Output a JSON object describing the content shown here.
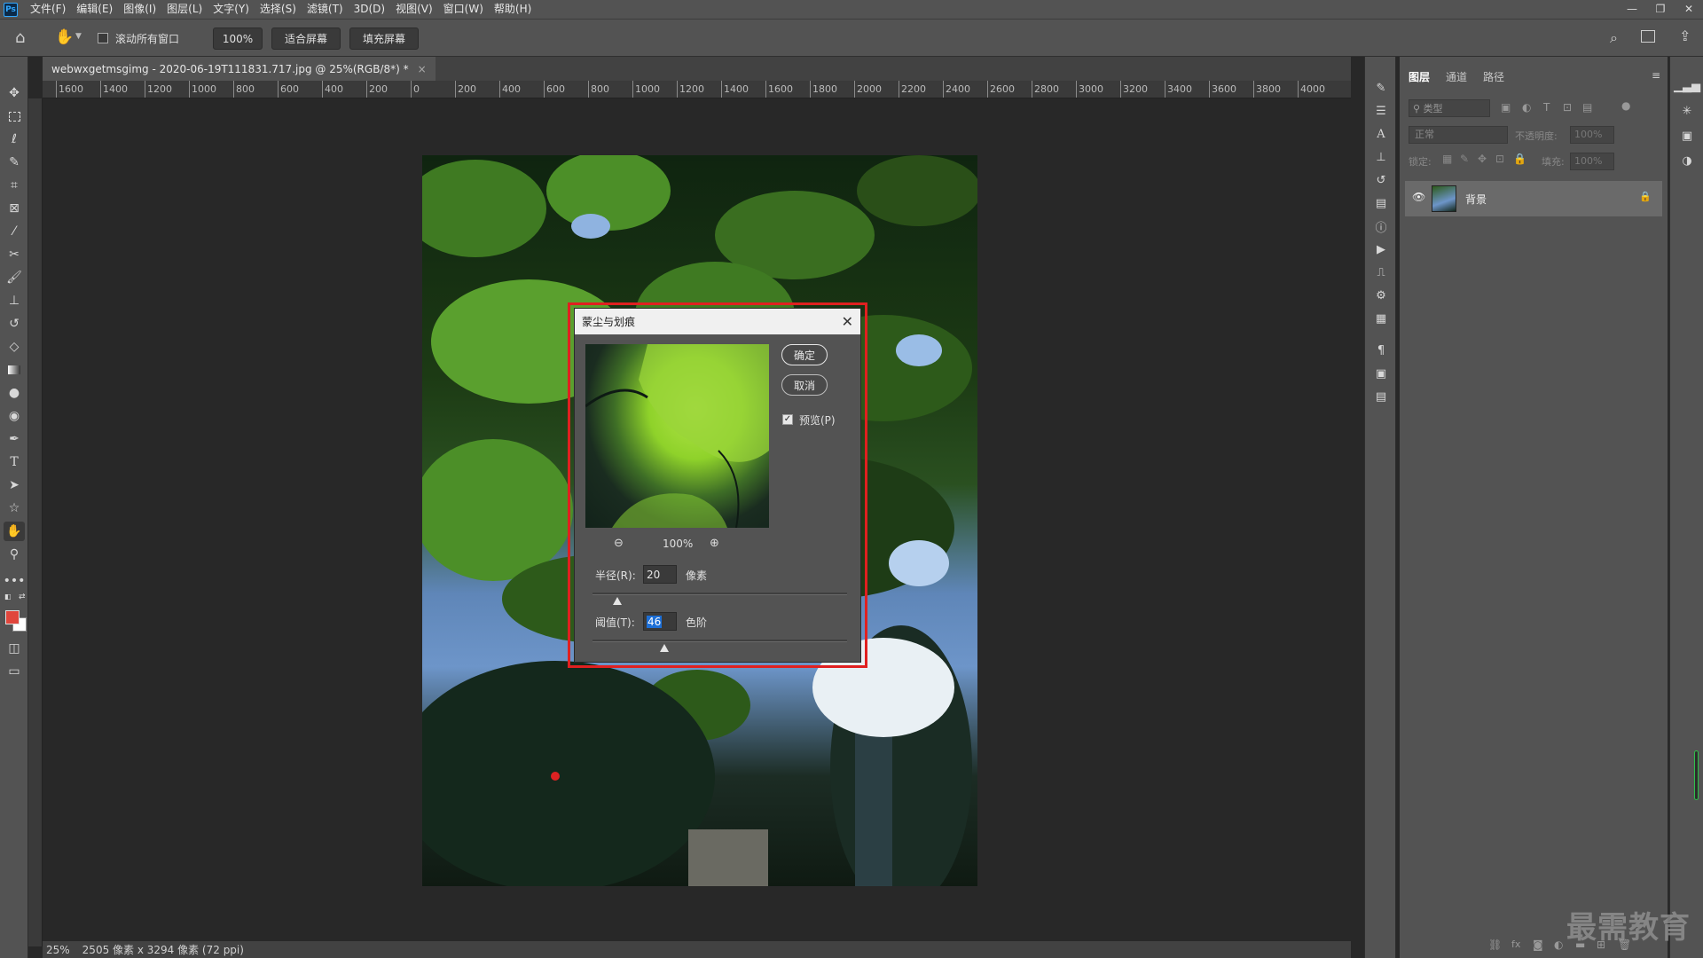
{
  "menubar": {
    "logo": "Ps",
    "items": [
      "文件(F)",
      "编辑(E)",
      "图像(I)",
      "图层(L)",
      "文字(Y)",
      "选择(S)",
      "滤镜(T)",
      "3D(D)",
      "视图(V)",
      "窗口(W)",
      "帮助(H)"
    ],
    "window_controls": [
      "—",
      "❐",
      "✕"
    ]
  },
  "options": {
    "scroll_all_label": "滚动所有窗口",
    "zoom_value": "100%",
    "fit_screen": "适合屏幕",
    "fill_screen": "填充屏幕"
  },
  "document": {
    "tab_title": "webwxgetmsgimg - 2020-06-19T111831.717.jpg @ 25%(RGB/8*) *",
    "tab_close": "×"
  },
  "ruler": {
    "labels": [
      "1600",
      "1400",
      "1200",
      "1000",
      "800",
      "600",
      "400",
      "200",
      "0",
      "200",
      "400",
      "600",
      "800",
      "1000",
      "1200",
      "1400",
      "1600",
      "1800",
      "2000",
      "2200",
      "2400",
      "2600",
      "2800",
      "3000",
      "3200",
      "3400",
      "3600",
      "3800",
      "4000"
    ]
  },
  "status": {
    "zoom": "25%",
    "info": "2505 像素 x 3294 像素 (72 ppi)"
  },
  "layers_panel": {
    "tabs": [
      "图层",
      "通道",
      "路径"
    ],
    "kind_placeholder": "类型",
    "blend_mode": "正常",
    "opacity_label": "不透明度:",
    "opacity_value": "100%",
    "lock_label": "锁定:",
    "fill_label": "填充:",
    "fill_value": "100%",
    "layer_name": "背景"
  },
  "dialog": {
    "title": "蒙尘与划痕",
    "ok": "确定",
    "cancel": "取消",
    "preview_label": "预览(P)",
    "preview_checked": true,
    "zoom": "100%",
    "radius_label": "半径(R):",
    "radius_value": "20",
    "radius_unit": "像素",
    "threshold_label": "阈值(T):",
    "threshold_value": "46",
    "threshold_unit": "色阶"
  },
  "watermark": "最需教育",
  "colors": {
    "foreground": "#e0463c",
    "background": "#ffffff",
    "highlight": "#e02020"
  }
}
